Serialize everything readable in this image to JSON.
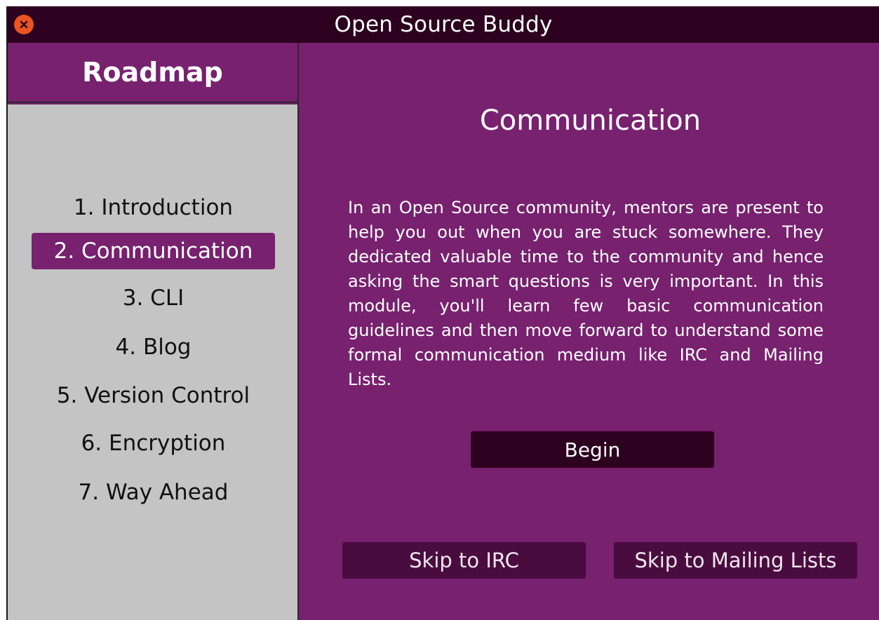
{
  "window": {
    "title": "Open Source Buddy",
    "close_icon": "close-icon"
  },
  "sidebar": {
    "title": "Roadmap",
    "items": [
      {
        "label": "1. Introduction",
        "active": false
      },
      {
        "label": "2. Communication",
        "active": true
      },
      {
        "label": "3. CLI",
        "active": false
      },
      {
        "label": "4. Blog",
        "active": false
      },
      {
        "label": "5. Version Control",
        "active": false
      },
      {
        "label": "6. Encryption",
        "active": false
      },
      {
        "label": "7. Way Ahead",
        "active": false
      }
    ]
  },
  "main": {
    "heading": "Communication",
    "description": "In an Open Source community, mentors are present to help you out when you are stuck somewhere. They dedicated valuable time to the community and hence asking the smart questions is very important. In this module, you'll learn few basic communication guidelines and then move forward to understand some formal communication medium like IRC and Mailing Lists.",
    "begin_label": "Begin",
    "skip_irc_label": "Skip to IRC",
    "skip_mailing_label": "Skip to Mailing Lists"
  },
  "colors": {
    "accent": "#77216f",
    "titlebar": "#2c001e",
    "sidebar_bg": "#c4c4c4",
    "close": "#e95420"
  }
}
